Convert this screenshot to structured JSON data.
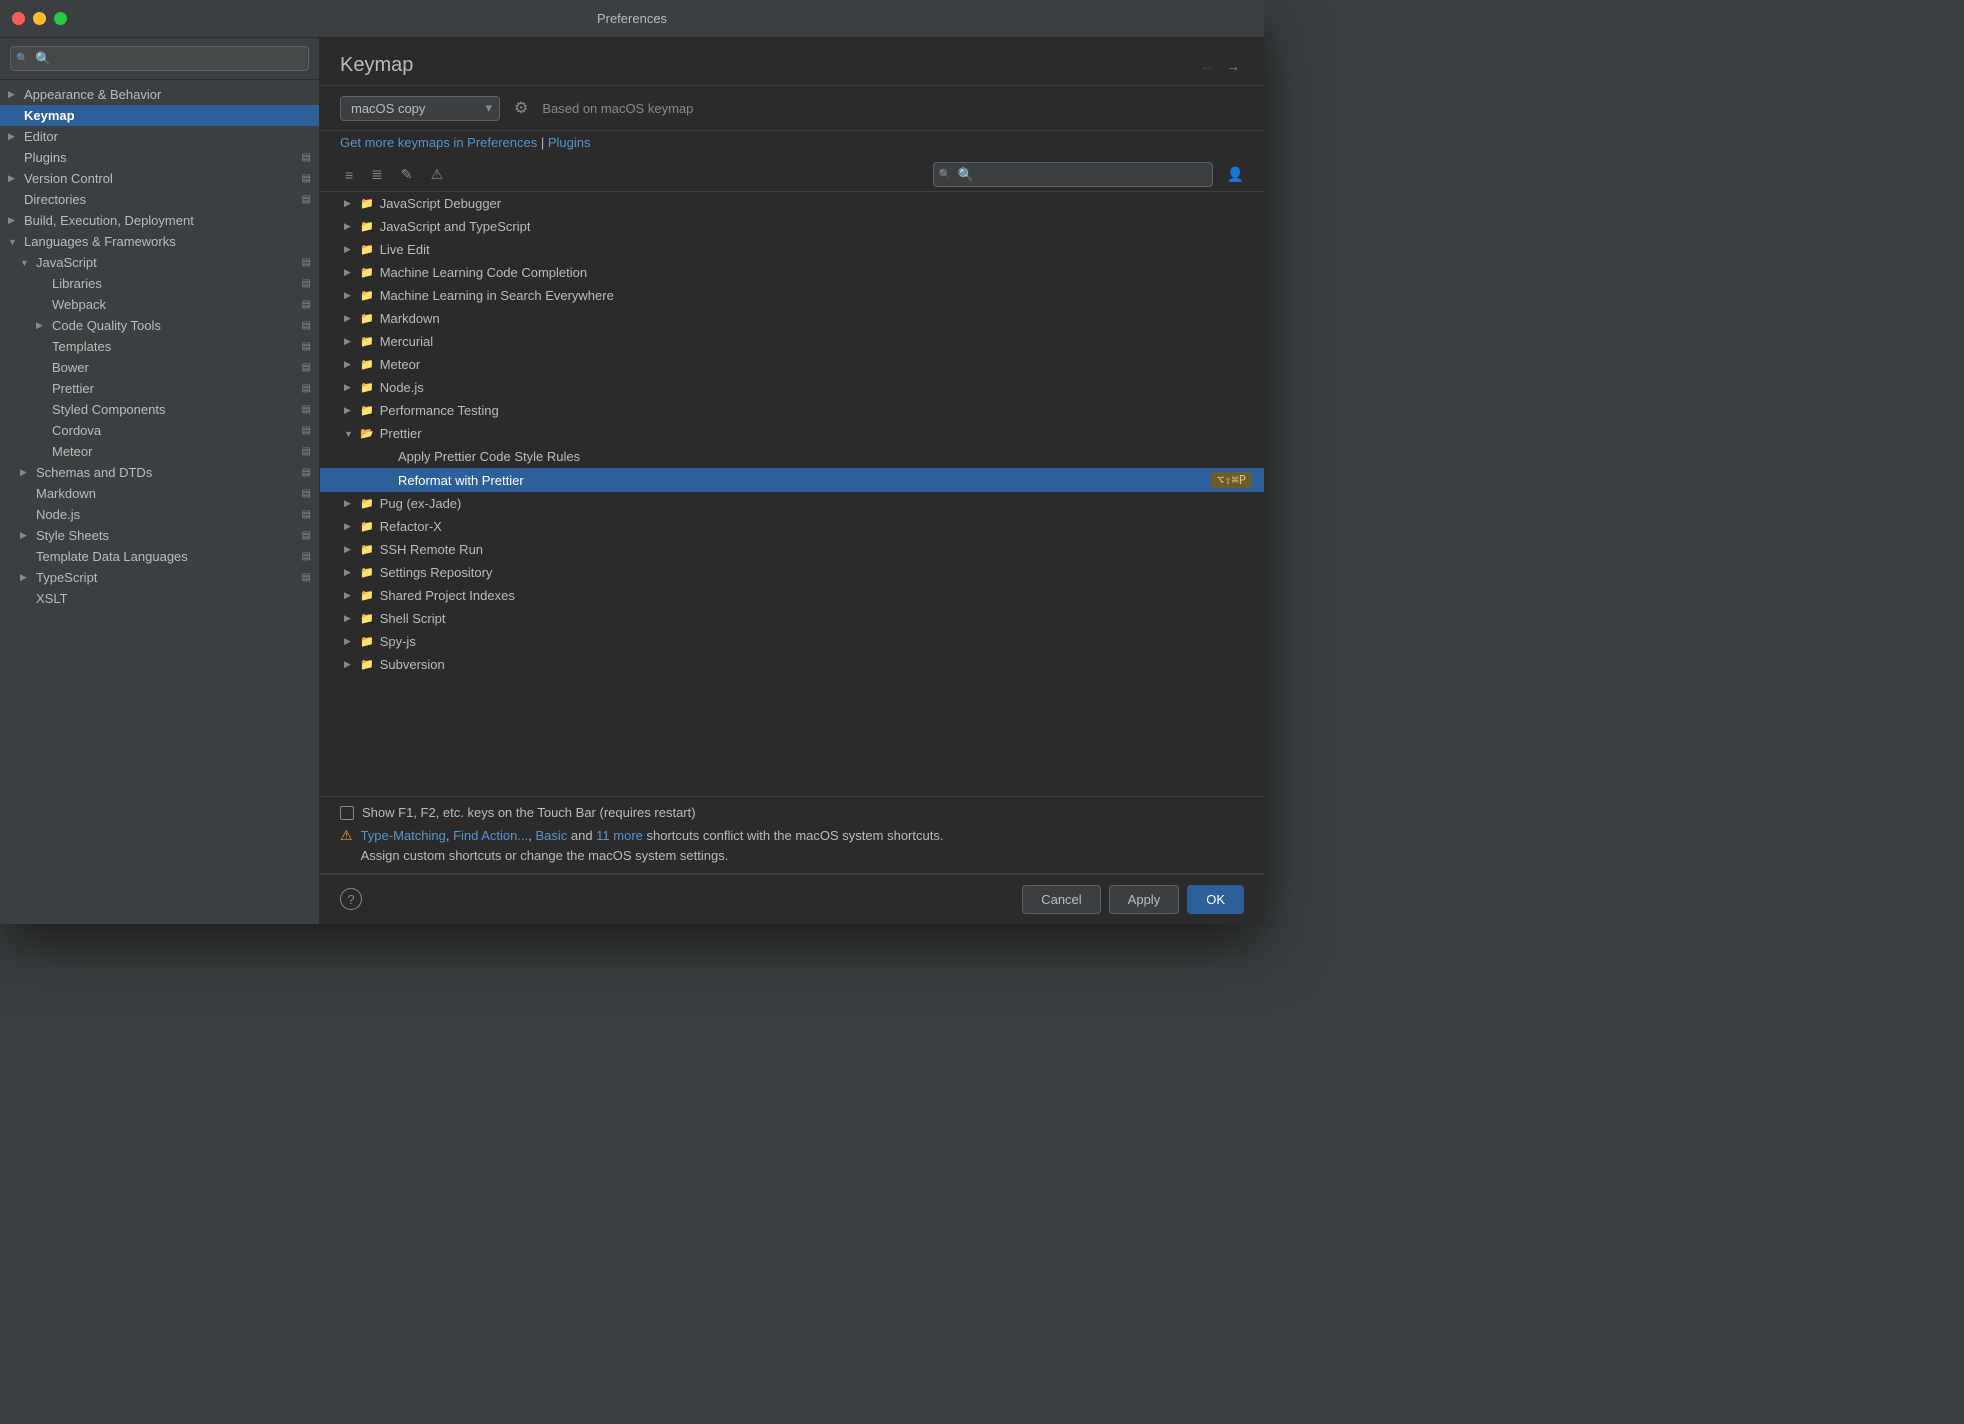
{
  "window": {
    "title": "Preferences"
  },
  "sidebar": {
    "search_placeholder": "🔍",
    "items": [
      {
        "id": "appearance",
        "label": "Appearance & Behavior",
        "level": 0,
        "chevron": "▶",
        "has_badge": false,
        "selected": false
      },
      {
        "id": "keymap",
        "label": "Keymap",
        "level": 0,
        "chevron": "",
        "has_badge": false,
        "selected": true
      },
      {
        "id": "editor",
        "label": "Editor",
        "level": 0,
        "chevron": "▶",
        "has_badge": false,
        "selected": false
      },
      {
        "id": "plugins",
        "label": "Plugins",
        "level": 0,
        "chevron": "",
        "has_badge": true,
        "selected": false
      },
      {
        "id": "version-control",
        "label": "Version Control",
        "level": 0,
        "chevron": "▶",
        "has_badge": true,
        "selected": false
      },
      {
        "id": "directories",
        "label": "Directories",
        "level": 0,
        "chevron": "",
        "has_badge": true,
        "selected": false
      },
      {
        "id": "build",
        "label": "Build, Execution, Deployment",
        "level": 0,
        "chevron": "▶",
        "has_badge": false,
        "selected": false
      },
      {
        "id": "languages",
        "label": "Languages & Frameworks",
        "level": 0,
        "chevron": "▼",
        "has_badge": false,
        "selected": false
      },
      {
        "id": "javascript",
        "label": "JavaScript",
        "level": 1,
        "chevron": "▼",
        "has_badge": true,
        "selected": false
      },
      {
        "id": "libraries",
        "label": "Libraries",
        "level": 2,
        "chevron": "",
        "has_badge": true,
        "selected": false
      },
      {
        "id": "webpack",
        "label": "Webpack",
        "level": 2,
        "chevron": "",
        "has_badge": true,
        "selected": false
      },
      {
        "id": "code-quality-tools",
        "label": "Code Quality Tools",
        "level": 2,
        "chevron": "▶",
        "has_badge": true,
        "selected": false
      },
      {
        "id": "templates",
        "label": "Templates",
        "level": 2,
        "chevron": "",
        "has_badge": true,
        "selected": false
      },
      {
        "id": "bower",
        "label": "Bower",
        "level": 2,
        "chevron": "",
        "has_badge": true,
        "selected": false
      },
      {
        "id": "prettier",
        "label": "Prettier",
        "level": 2,
        "chevron": "",
        "has_badge": true,
        "selected": false
      },
      {
        "id": "styled-components",
        "label": "Styled Components",
        "level": 2,
        "chevron": "",
        "has_badge": true,
        "selected": false
      },
      {
        "id": "cordova",
        "label": "Cordova",
        "level": 2,
        "chevron": "",
        "has_badge": true,
        "selected": false
      },
      {
        "id": "meteor-js",
        "label": "Meteor",
        "level": 2,
        "chevron": "",
        "has_badge": true,
        "selected": false
      },
      {
        "id": "schemas-dtds",
        "label": "Schemas and DTDs",
        "level": 1,
        "chevron": "▶",
        "has_badge": true,
        "selected": false
      },
      {
        "id": "markdown",
        "label": "Markdown",
        "level": 1,
        "chevron": "",
        "has_badge": true,
        "selected": false
      },
      {
        "id": "nodejs",
        "label": "Node.js",
        "level": 1,
        "chevron": "",
        "has_badge": true,
        "selected": false
      },
      {
        "id": "style-sheets",
        "label": "Style Sheets",
        "level": 1,
        "chevron": "▶",
        "has_badge": true,
        "selected": false
      },
      {
        "id": "template-data-languages",
        "label": "Template Data Languages",
        "level": 1,
        "chevron": "",
        "has_badge": true,
        "selected": false
      },
      {
        "id": "typescript",
        "label": "TypeScript",
        "level": 1,
        "chevron": "▶",
        "has_badge": true,
        "selected": false
      },
      {
        "id": "xslt",
        "label": "XSLT",
        "level": 1,
        "chevron": "",
        "has_badge": false,
        "selected": false
      }
    ]
  },
  "panel": {
    "title": "Keymap",
    "keymap_value": "macOS copy",
    "keymap_description": "Based on macOS keymap",
    "get_keymaps_text": "Get more keymaps in Preferences",
    "pipe": "|",
    "plugins_link": "Plugins"
  },
  "keymap_tree": {
    "rows": [
      {
        "id": "js-debugger",
        "label": "JavaScript Debugger",
        "level": 1,
        "type": "folder",
        "chevron": "▶",
        "selected": false
      },
      {
        "id": "js-typescript",
        "label": "JavaScript and TypeScript",
        "level": 1,
        "type": "folder",
        "chevron": "▶",
        "selected": false
      },
      {
        "id": "live-edit",
        "label": "Live Edit",
        "level": 1,
        "type": "folder",
        "chevron": "▶",
        "selected": false
      },
      {
        "id": "ml-code-completion",
        "label": "Machine Learning Code Completion",
        "level": 1,
        "type": "folder",
        "chevron": "▶",
        "selected": false
      },
      {
        "id": "ml-search-everywhere",
        "label": "Machine Learning in Search Everywhere",
        "level": 1,
        "type": "folder",
        "chevron": "▶",
        "selected": false
      },
      {
        "id": "markdown",
        "label": "Markdown",
        "level": 1,
        "type": "folder",
        "chevron": "▶",
        "selected": false
      },
      {
        "id": "mercurial",
        "label": "Mercurial",
        "level": 1,
        "type": "folder",
        "chevron": "▶",
        "selected": false
      },
      {
        "id": "meteor",
        "label": "Meteor",
        "level": 1,
        "type": "folder",
        "chevron": "▶",
        "selected": false
      },
      {
        "id": "nodejs",
        "label": "Node.js",
        "level": 1,
        "type": "folder",
        "chevron": "▶",
        "selected": false
      },
      {
        "id": "performance-testing",
        "label": "Performance Testing",
        "level": 1,
        "type": "folder",
        "chevron": "▶",
        "selected": false
      },
      {
        "id": "prettier-folder",
        "label": "Prettier",
        "level": 1,
        "type": "folder-open",
        "chevron": "▼",
        "selected": false
      },
      {
        "id": "apply-prettier",
        "label": "Apply Prettier Code Style Rules",
        "level": 2,
        "type": "action",
        "chevron": "",
        "selected": false
      },
      {
        "id": "reformat-prettier",
        "label": "Reformat with Prettier",
        "level": 2,
        "type": "action",
        "chevron": "",
        "selected": true,
        "shortcut": "⌥⇧⌘P"
      },
      {
        "id": "pug",
        "label": "Pug (ex-Jade)",
        "level": 1,
        "type": "folder",
        "chevron": "▶",
        "selected": false
      },
      {
        "id": "refactor-x",
        "label": "Refactor-X",
        "level": 1,
        "type": "folder",
        "chevron": "▶",
        "selected": false
      },
      {
        "id": "ssh-remote-run",
        "label": "SSH Remote Run",
        "level": 1,
        "type": "folder",
        "chevron": "▶",
        "selected": false
      },
      {
        "id": "settings-repo",
        "label": "Settings Repository",
        "level": 1,
        "type": "folder",
        "chevron": "▶",
        "selected": false
      },
      {
        "id": "shared-project-indexes",
        "label": "Shared Project Indexes",
        "level": 1,
        "type": "folder",
        "chevron": "▶",
        "selected": false
      },
      {
        "id": "shell-script",
        "label": "Shell Script",
        "level": 1,
        "type": "folder",
        "chevron": "▶",
        "selected": false
      },
      {
        "id": "spy-js",
        "label": "Spy-js",
        "level": 1,
        "type": "folder",
        "chevron": "▶",
        "selected": false
      },
      {
        "id": "subversion",
        "label": "Subversion",
        "level": 1,
        "type": "folder",
        "chevron": "▶",
        "selected": false
      }
    ]
  },
  "footer": {
    "touch_bar_label": "Show F1, F2, etc. keys on the Touch Bar (requires restart)",
    "warning_text_start": "Type-Matching",
    "warning_comma1": ", ",
    "warning_link2": "Find Action...",
    "warning_comma2": ", ",
    "warning_link3": "Basic",
    "warning_and": " and ",
    "warning_link4": "11 more",
    "warning_suffix": " shortcuts conflict with the macOS system shortcuts.",
    "warning_line2": "Assign custom shortcuts or change the macOS system settings."
  },
  "buttons": {
    "cancel": "Cancel",
    "apply": "Apply",
    "ok": "OK"
  },
  "action_toolbar": {
    "btn1": "≡",
    "btn2": "≣",
    "btn3": "✎",
    "btn4": "⚠",
    "search_placeholder": "🔍"
  }
}
